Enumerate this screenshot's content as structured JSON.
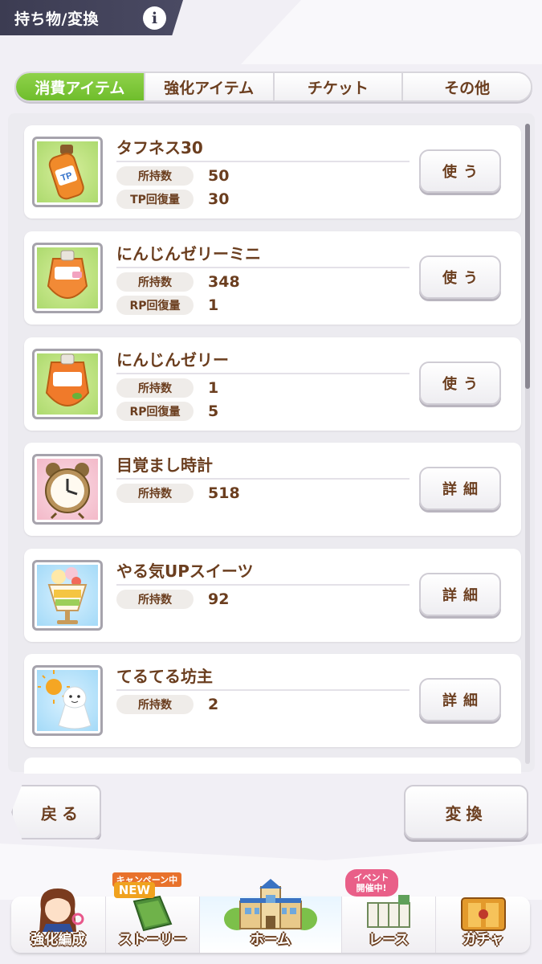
{
  "header": {
    "title": "持ち物/変換",
    "info_icon": "i"
  },
  "tabs": [
    {
      "label": "消費アイテム",
      "active": true
    },
    {
      "label": "強化アイテム",
      "active": false
    },
    {
      "label": "チケット",
      "active": false
    },
    {
      "label": "その他",
      "active": false
    }
  ],
  "items": [
    {
      "name": "タフネス30",
      "icon": "tp-bottle-icon",
      "stats": [
        {
          "label": "所持数",
          "value": "50"
        },
        {
          "label": "TP回復量",
          "value": "30"
        }
      ],
      "button": "使う"
    },
    {
      "name": "にんじんゼリーミニ",
      "icon": "carrot-jelly-mini-icon",
      "stats": [
        {
          "label": "所持数",
          "value": "348"
        },
        {
          "label": "RP回復量",
          "value": "1"
        }
      ],
      "button": "使う"
    },
    {
      "name": "にんじんゼリー",
      "icon": "carrot-jelly-icon",
      "stats": [
        {
          "label": "所持数",
          "value": "1"
        },
        {
          "label": "RP回復量",
          "value": "5"
        }
      ],
      "button": "使う"
    },
    {
      "name": "目覚まし時計",
      "icon": "alarm-clock-icon",
      "stats": [
        {
          "label": "所持数",
          "value": "518"
        }
      ],
      "button": "詳細"
    },
    {
      "name": "やる気UPスイーツ",
      "icon": "parfait-icon",
      "stats": [
        {
          "label": "所持数",
          "value": "92"
        }
      ],
      "button": "詳細"
    },
    {
      "name": "てるてる坊主",
      "icon": "teru-teru-bozu-icon",
      "stats": [
        {
          "label": "所持数",
          "value": "2"
        }
      ],
      "button": "詳細"
    }
  ],
  "footer": {
    "back_label": "戻る",
    "convert_label": "変換"
  },
  "nav": {
    "items": [
      {
        "label": "強化編成"
      },
      {
        "label": "ストーリー",
        "badge_top": "キャンペーン中",
        "badge_new": "NEW"
      },
      {
        "label": "ホーム"
      },
      {
        "label": "レース",
        "badge_event": "イベント\n開催中!"
      },
      {
        "label": "ガチャ"
      }
    ]
  },
  "colors": {
    "accent_green": "#76c12f",
    "text_brown": "#6b3e1f",
    "header_dark": "#3c3c52"
  }
}
